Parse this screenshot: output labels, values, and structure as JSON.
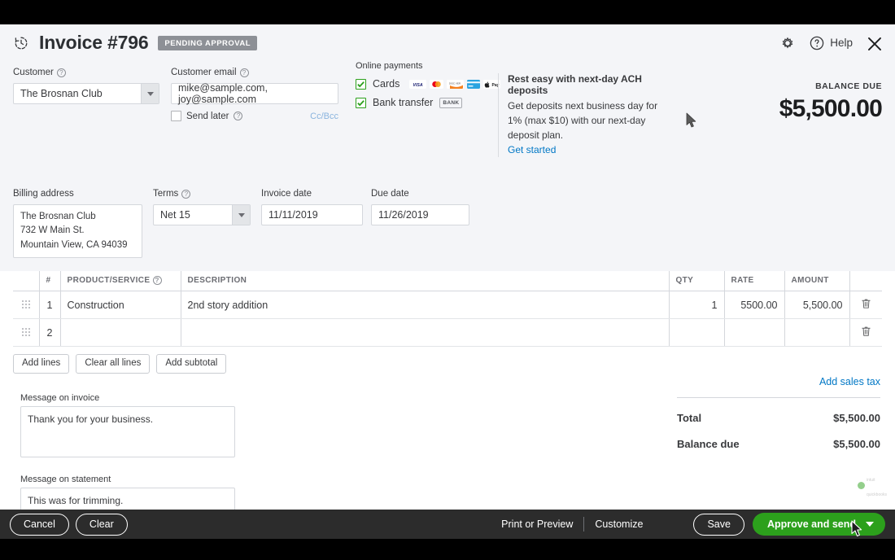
{
  "header": {
    "status_icon": "recurring-clock-icon",
    "title": "Invoice #796",
    "status_badge": "PENDING APPROVAL",
    "gear_icon": "gear-icon",
    "help_icon": "question-circle-icon",
    "help_label": "Help",
    "close_icon": "close-icon"
  },
  "customer": {
    "label": "Customer",
    "value": "The Brosnan Club",
    "help_icon": "question-mark-icon",
    "dropdown_icon": "chevron-down-icon"
  },
  "customer_email": {
    "label": "Customer email",
    "value": "mike@sample.com, joy@sample.com",
    "help_icon": "question-mark-icon",
    "send_later_label": "Send later",
    "send_later_checked": false,
    "cc_bcc_label": "Cc/Bcc"
  },
  "online_payments": {
    "title": "Online payments",
    "rows": [
      {
        "label": "Cards",
        "checked": true,
        "logos": [
          "visa-logo",
          "mastercard-logo",
          "discover-logo",
          "card-logo",
          "apple-pay-logo"
        ]
      },
      {
        "label": "Bank transfer",
        "checked": true,
        "chip": "BANK"
      }
    ]
  },
  "ach_promo": {
    "heading": "Rest easy with next-day ACH deposits",
    "body": "Get deposits next business day for 1% (max $10) with our next-day deposit plan.",
    "link": "Get started"
  },
  "balance_due": {
    "label": "BALANCE DUE",
    "amount": "$5,500.00"
  },
  "billing_address": {
    "label": "Billing address",
    "line1": "The Brosnan Club",
    "line2": "732 W Main St.",
    "line3": "Mountain View, CA 94039"
  },
  "terms": {
    "label": "Terms",
    "value": "Net 15",
    "help_icon": "question-mark-icon",
    "dropdown_icon": "chevron-down-icon"
  },
  "invoice_date": {
    "label": "Invoice date",
    "value": "11/11/2019"
  },
  "due_date": {
    "label": "Due date",
    "value": "11/26/2019"
  },
  "line_items": {
    "columns": {
      "handle": "",
      "num": "#",
      "product": "PRODUCT/SERVICE",
      "description": "DESCRIPTION",
      "qty": "QTY",
      "rate": "RATE",
      "amount": "AMOUNT",
      "delete": ""
    },
    "product_help_icon": "question-mark-icon",
    "rows": [
      {
        "handle_icon": "drag-handle-icon",
        "num": "1",
        "product": "Construction",
        "description": "2nd story addition",
        "qty": "1",
        "rate": "5500.00",
        "amount": "5,500.00",
        "delete_icon": "trash-icon"
      },
      {
        "handle_icon": "drag-handle-icon",
        "num": "2",
        "product": "",
        "description": "",
        "qty": "",
        "rate": "",
        "amount": "",
        "delete_icon": "trash-icon"
      }
    ]
  },
  "line_controls": {
    "add_lines": "Add lines",
    "clear_all_lines": "Clear all lines",
    "add_subtotal": "Add subtotal"
  },
  "messages": {
    "invoice_label": "Message on invoice",
    "invoice_value": "Thank you for your business.",
    "statement_label": "Message on statement",
    "statement_value": "This was for trimming."
  },
  "totals": {
    "add_sales_tax": "Add sales tax",
    "rows": [
      {
        "label": "Total",
        "value": "$5,500.00"
      },
      {
        "label": "Balance due",
        "value": "$5,500.00"
      }
    ]
  },
  "bottom_bar": {
    "cancel": "Cancel",
    "clear": "Clear",
    "print_or_preview": "Print or Preview",
    "customize": "Customize",
    "save": "Save",
    "approve_and_send": "Approve and send",
    "approve_caret_icon": "chevron-down-icon"
  },
  "watermark": {
    "brand_top": "intuit",
    "brand_bottom": "quickbooks"
  },
  "colors": {
    "accent_green": "#2ca01c",
    "link_blue": "#0077c5",
    "form_bg": "#f4f5f8",
    "bottom_bar": "#2c2c2c",
    "badge_gray": "#8d9096"
  }
}
